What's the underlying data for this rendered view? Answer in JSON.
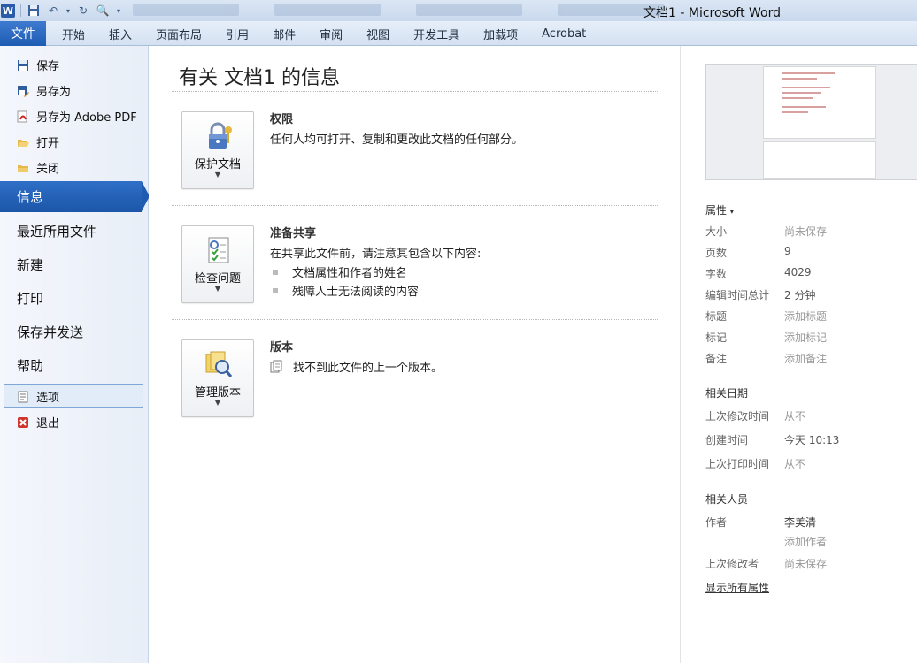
{
  "window": {
    "title": "文档1 - Microsoft Word",
    "app_icon": "W"
  },
  "ribbon": {
    "file_tab": "文件",
    "tabs": [
      "开始",
      "插入",
      "页面布局",
      "引用",
      "邮件",
      "审阅",
      "视图",
      "开发工具",
      "加载项",
      "Acrobat"
    ]
  },
  "leftnav": {
    "commands": [
      {
        "label": "保存",
        "icon": "save-icon"
      },
      {
        "label": "另存为",
        "icon": "save-as-icon"
      },
      {
        "label": "另存为 Adobe PDF",
        "icon": "pdf-icon"
      },
      {
        "label": "打开",
        "icon": "open-folder-icon"
      },
      {
        "label": "关闭",
        "icon": "close-folder-icon"
      }
    ],
    "info": "信息",
    "sections": [
      "最近所用文件",
      "新建",
      "打印",
      "保存并发送",
      "帮助"
    ],
    "options": "选项",
    "exit": "退出"
  },
  "main": {
    "title": "有关 文档1 的信息",
    "permissions": {
      "button": "保护文档",
      "title": "权限",
      "text": "任何人均可打开、复制和更改此文档的任何部分。"
    },
    "sharing": {
      "button": "检查问题",
      "title": "准备共享",
      "text": "在共享此文件前，请注意其包含以下内容:",
      "bullets": [
        "文档属性和作者的姓名",
        "残障人士无法阅读的内容"
      ]
    },
    "versions": {
      "button": "管理版本",
      "title": "版本",
      "text": "找不到此文件的上一个版本。"
    }
  },
  "properties": {
    "header": "属性",
    "rows": [
      {
        "label": "大小",
        "value": "尚未保存"
      },
      {
        "label": "页数",
        "value": "9"
      },
      {
        "label": "字数",
        "value": "4029"
      },
      {
        "label": "编辑时间总计",
        "value": "2 分钟"
      },
      {
        "label": "标题",
        "value": "添加标题"
      },
      {
        "label": "标记",
        "value": "添加标记"
      },
      {
        "label": "备注",
        "value": "添加备注"
      }
    ],
    "dates_header": "相关日期",
    "dates": [
      {
        "label": "上次修改时间",
        "value": "从不"
      },
      {
        "label": "创建时间",
        "value": "今天 10:13"
      },
      {
        "label": "上次打印时间",
        "value": "从不"
      }
    ],
    "people_header": "相关人员",
    "author_label": "作者",
    "author": "李美清",
    "add_author": "添加作者",
    "last_modified_by_label": "上次修改者",
    "last_modified_by": "尚未保存",
    "show_all": "显示所有属性"
  }
}
